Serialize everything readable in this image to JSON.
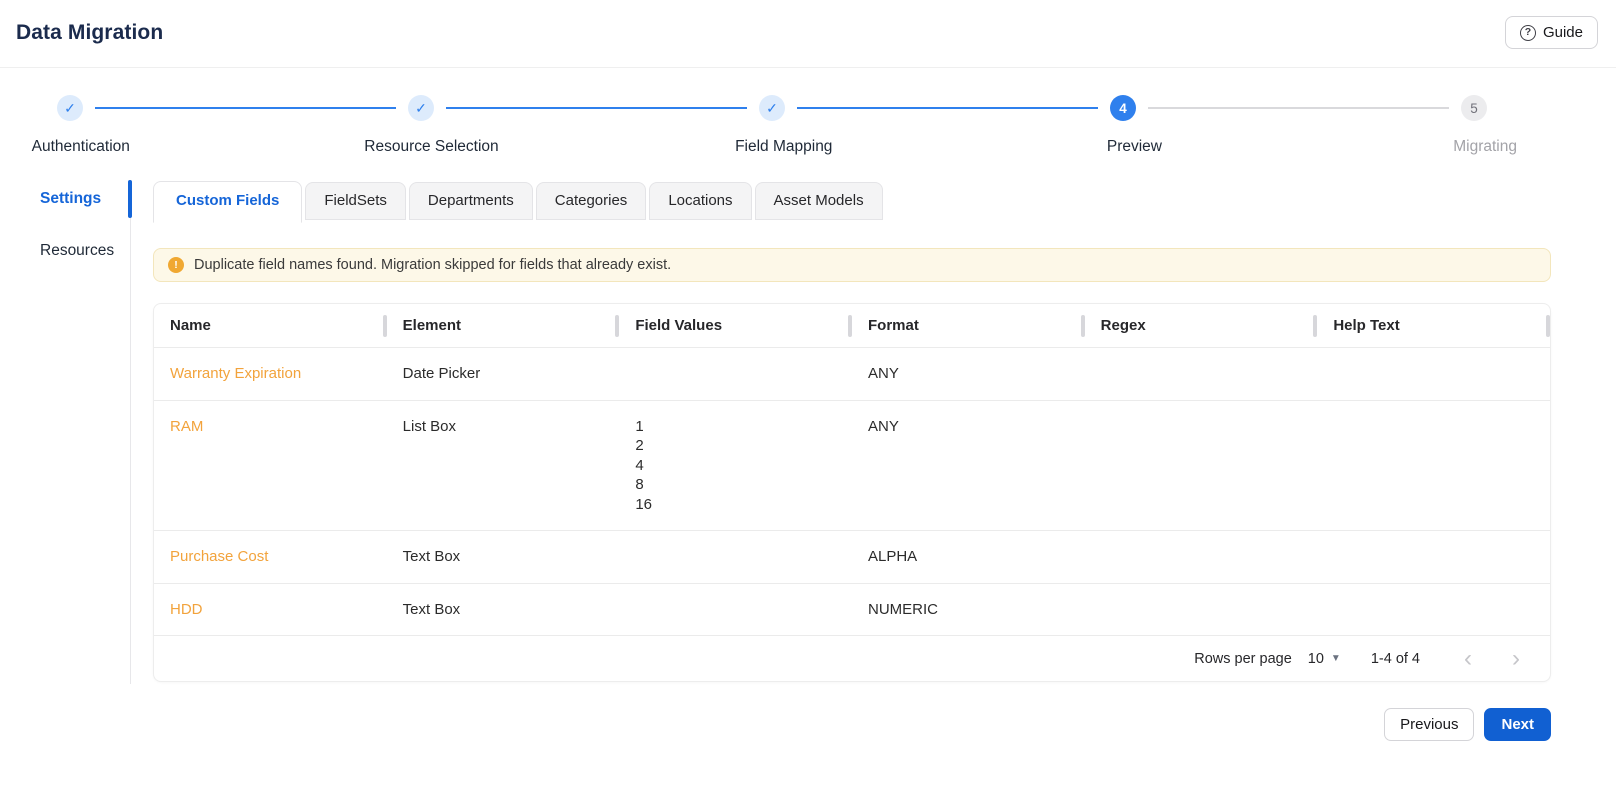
{
  "header": {
    "title": "Data Migration",
    "guide_label": "Guide"
  },
  "icons": {
    "help": "?",
    "check": "✓",
    "warning": "!",
    "dropdown_arrow": "▼",
    "chevron_left": "‹",
    "chevron_right": "›"
  },
  "stepper": {
    "steps": [
      {
        "label": "Authentication",
        "state": "complete"
      },
      {
        "label": "Resource Selection",
        "state": "complete"
      },
      {
        "label": "Field Mapping",
        "state": "complete"
      },
      {
        "label": "Preview",
        "state": "active",
        "number": "4"
      },
      {
        "label": "Migrating",
        "state": "pending",
        "number": "5"
      }
    ]
  },
  "sidebar": {
    "items": [
      {
        "label": "Settings",
        "active": true
      },
      {
        "label": "Resources",
        "active": false
      }
    ]
  },
  "tabs": [
    {
      "label": "Custom Fields",
      "active": true
    },
    {
      "label": "FieldSets",
      "active": false
    },
    {
      "label": "Departments",
      "active": false
    },
    {
      "label": "Categories",
      "active": false
    },
    {
      "label": "Locations",
      "active": false
    },
    {
      "label": "Asset Models",
      "active": false
    }
  ],
  "banner": {
    "text": "Duplicate field names found. Migration skipped for fields that already exist."
  },
  "table": {
    "columns": [
      "Name",
      "Element",
      "Field Values",
      "Format",
      "Regex",
      "Help Text"
    ],
    "rows": [
      {
        "name": "Warranty Expiration",
        "element": "Date Picker",
        "field_values": [],
        "format": "ANY",
        "regex": "",
        "help_text": ""
      },
      {
        "name": "RAM",
        "element": "List Box",
        "field_values": [
          "1",
          "2",
          "4",
          "8",
          "16"
        ],
        "format": "ANY",
        "regex": "",
        "help_text": ""
      },
      {
        "name": "Purchase Cost",
        "element": "Text Box",
        "field_values": [],
        "format": "ALPHA",
        "regex": "",
        "help_text": ""
      },
      {
        "name": "HDD",
        "element": "Text Box",
        "field_values": [],
        "format": "NUMERIC",
        "regex": "",
        "help_text": ""
      }
    ],
    "pagination": {
      "rows_per_page_label": "Rows per page",
      "rows_per_page_value": "10",
      "range_label": "1-4 of 4"
    }
  },
  "footer": {
    "previous_label": "Previous",
    "next_label": "Next"
  },
  "colors": {
    "accent": "#1565d8",
    "step-blue": "#2f80ed",
    "title-navy": "#1b2b4d",
    "link-orange": "#f2a33c",
    "warning-bg": "#fdf8e8",
    "warning-border": "#f3e6bc",
    "warning-icon": "#f0a832",
    "next-button": "#1160d2"
  }
}
